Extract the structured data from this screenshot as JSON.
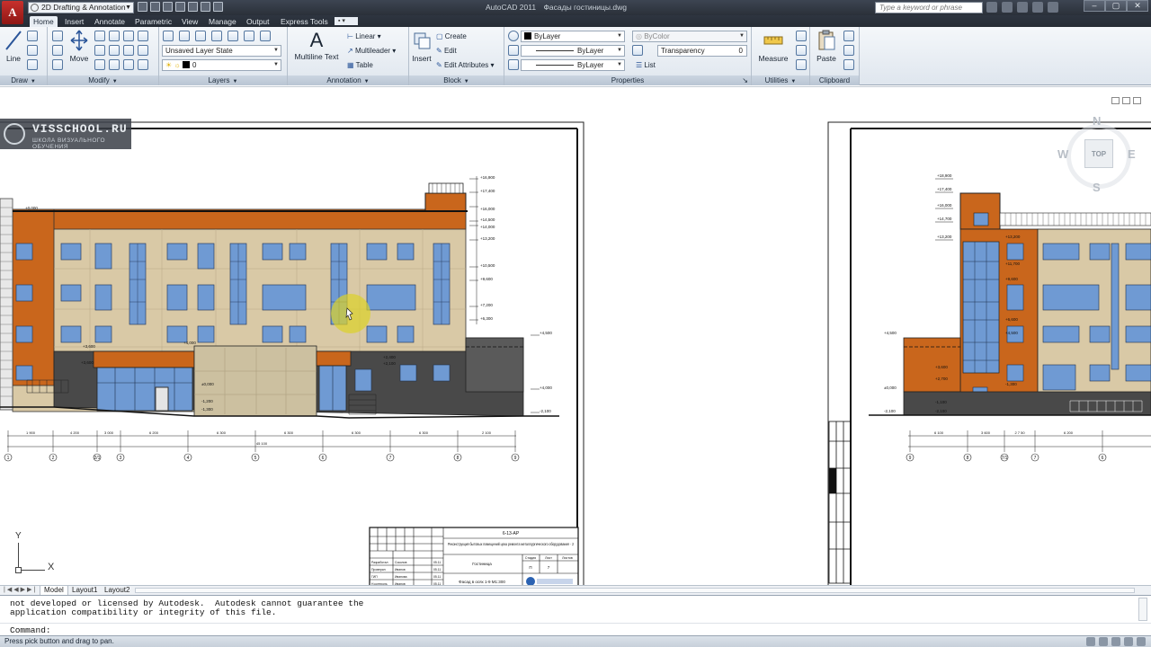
{
  "app": {
    "logo_letter": "A",
    "workspace": "2D Drafting & Annotation",
    "window_title": "AutoCAD 2011",
    "file_name": "Фасады гостиницы.dwg",
    "search_placeholder": "Type a keyword or phrase",
    "window_buttons": [
      "–",
      "▢",
      "✕"
    ]
  },
  "ribbon_tabs": [
    "Home",
    "Insert",
    "Annotate",
    "Parametric",
    "View",
    "Manage",
    "Output",
    "Express Tools"
  ],
  "ribbon": {
    "draw": {
      "title": "Draw",
      "line_label": "Line"
    },
    "modify": {
      "title": "Modify",
      "move_label": "Move"
    },
    "layers": {
      "title": "Layers",
      "layer_state": "Unsaved Layer State",
      "current_layer": "0"
    },
    "annotation": {
      "title": "Annotation",
      "multiline_text_big": "A",
      "multiline_text": "Multiline Text",
      "linear": "Linear",
      "multileader": "Multileader",
      "table": "Table"
    },
    "block": {
      "title": "Block",
      "insert": "Insert",
      "create": "Create",
      "edit": "Edit",
      "edit_attributes": "Edit Attributes"
    },
    "properties": {
      "title": "Properties",
      "color": "ByLayer",
      "linetype": "ByLayer",
      "lineweight": "ByLayer",
      "plot_style": "ByColor",
      "transparency_label": "Transparency",
      "transparency_value": "0",
      "list": "List"
    },
    "utilities": {
      "title": "Utilities",
      "measure": "Measure"
    },
    "clipboard": {
      "title": "Clipboard",
      "paste": "Paste"
    }
  },
  "watermark": {
    "title": "VISSCHOOL.RU",
    "subtitle": "ШКОЛА ВИЗУАЛЬНОГО ОБУЧЕНИЯ"
  },
  "viewcube": {
    "top": "TOP",
    "north": "N",
    "south": "S",
    "east": "E",
    "west": "W"
  },
  "ucs": {
    "x_label": "X",
    "y_label": "Y"
  },
  "drawing": {
    "left_levels": [
      "+16,900",
      "+17,400",
      "+16,000",
      "+14,500",
      "+14,000",
      "+13,200",
      "+10,500",
      "+9,600",
      "+7,200",
      "+6,300",
      "+4,500",
      "+4,000",
      "+3,600",
      "+2,400",
      "+2,100",
      "±0,000",
      "-1,200",
      "-1,300",
      "-2,100",
      "+4,000",
      "+3,600",
      "+0,000"
    ],
    "right_levels": [
      "+18,900",
      "+17,400",
      "+16,000",
      "+14,700",
      "+13,200",
      "+13,200",
      "+11,700",
      "+9,600",
      "+6,600",
      "+4,500",
      "+4,500",
      "+3,600",
      "+2,700",
      "±0,000",
      "-1,100",
      "-1,300",
      "-2,100",
      "-2,100"
    ],
    "left_axes": [
      "1",
      "2",
      "2/1",
      "3",
      "4",
      "5",
      "6",
      "7",
      "8",
      "9"
    ],
    "right_axes": [
      "9",
      "8",
      "7/1",
      "7",
      "6"
    ],
    "left_dims": [
      "1 900",
      "4 200",
      "3 000",
      "6 200",
      "6 300",
      "6 300",
      "6 300",
      "6 300",
      "6 300",
      "6 300",
      "2 100",
      "45 100"
    ],
    "right_dims": [
      "6 100",
      "3 600",
      "2 7 50",
      "6 200"
    ],
    "title_block": {
      "code": "6-13-АР",
      "project": "Реконструкция бытовых помещений цеха ремонта металлургического оборудования - 2",
      "building": "Гостиница",
      "sheet_header": [
        "Стадия",
        "Лист",
        "Листов"
      ],
      "stage": "П",
      "sheet": "7",
      "drawing_title": "Фасад в осях 1-9 М1:300",
      "roles": [
        "Разработал",
        "Проверил",
        "ГИП",
        "Н.контроль"
      ],
      "names": [
        "Соколов",
        "Иванов",
        "Иванова",
        "Иванов"
      ],
      "dates": [
        "05.11",
        "05.11",
        "05.11",
        "05.11"
      ]
    }
  },
  "layout_tabs": [
    "Model",
    "Layout1",
    "Layout2"
  ],
  "command": {
    "line1": "not developed or licensed by Autodesk.  Autodesk cannot guarantee the",
    "line2": "application compatibility or integrity of this file.",
    "prompt": "Command:"
  },
  "status": {
    "text": "Press pick button and drag to pan."
  },
  "colors": {
    "orange": "#c9661c",
    "beige": "#d9c9a6",
    "window": "#6f9ad3",
    "dark": "#494949",
    "ribbon": "#e4eaf1"
  }
}
